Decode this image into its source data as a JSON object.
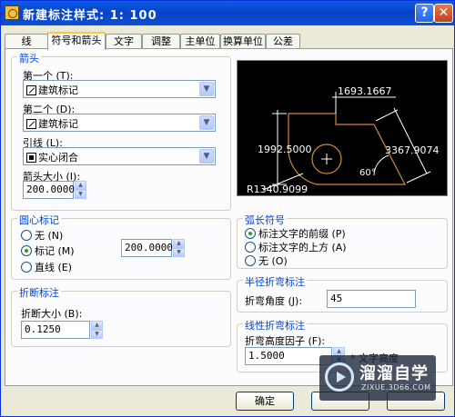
{
  "window": {
    "title": "新建标注样式: 1: 100",
    "help": "?",
    "close": "✕"
  },
  "tabs": [
    "线",
    "符号和箭头",
    "文字",
    "调整",
    "主单位",
    "换算单位",
    "公差"
  ],
  "arrows": {
    "legend": "箭头",
    "first_label": "第一个 (T):",
    "first_value": "建筑标记",
    "second_label": "第二个 (D):",
    "second_value": "建筑标记",
    "leader_label": "引线 (L):",
    "leader_value": "实心闭合",
    "size_label": "箭头大小 (I):",
    "size_value": "200.0000"
  },
  "preview": {
    "dim_top": "1693.1667",
    "dim_left": "1992.5000",
    "dim_right": "3367.9074",
    "angle": "60°",
    "radius": "R1340.9099"
  },
  "center_marks": {
    "legend": "圆心标记",
    "options": [
      "无 (N)",
      "标记 (M)",
      "直线 (E)"
    ],
    "selected": 1,
    "value": "200.0000"
  },
  "arc_length": {
    "legend": "弧长符号",
    "options": [
      "标注文字的前缀 (P)",
      "标注文字的上方 (A)",
      "无 (O)"
    ],
    "selected": 0
  },
  "dim_break": {
    "legend": "折断标注",
    "size_label": "折断大小 (B):",
    "size_value": "0.1250"
  },
  "radius_jog": {
    "legend": "半径折弯标注",
    "angle_label": "折弯角度 (J):",
    "angle_value": "45"
  },
  "linear_jog": {
    "legend": "线性折弯标注",
    "factor_label": "折弯高度因子 (F):",
    "factor_value": "1.5000",
    "factor_suffix": "* 文字高度"
  },
  "buttons": {
    "ok": "确定"
  },
  "watermark": {
    "big": "溜溜自学",
    "small": "ZIXUE.3D66.COM"
  }
}
